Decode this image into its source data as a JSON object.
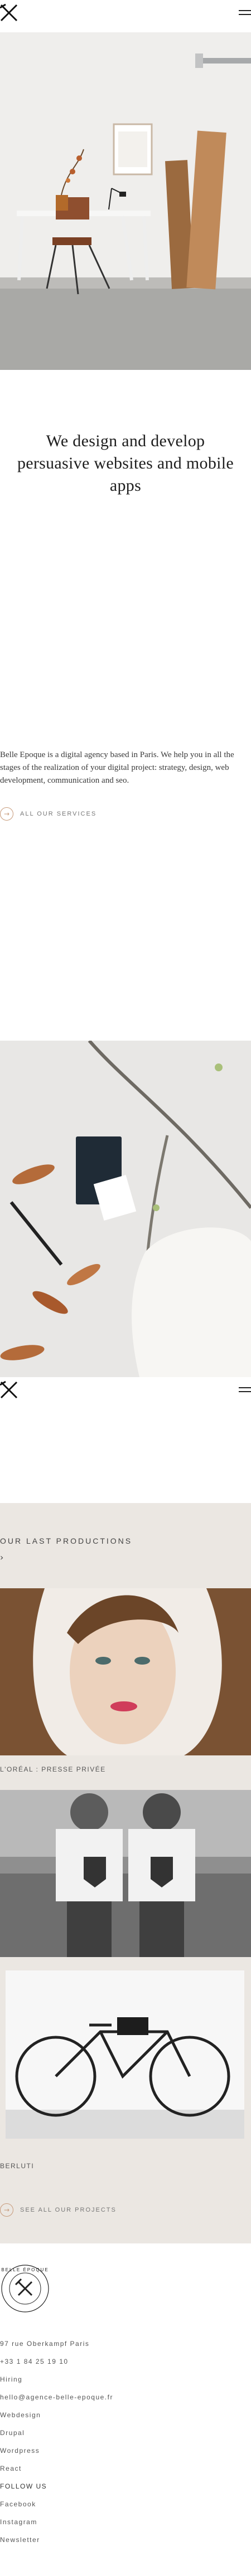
{
  "colors": {
    "accent": "#c79a7a",
    "section_bg": "#ebe7e2",
    "text": "#2a2a2a"
  },
  "header": {
    "logo_icon": "crossed-x-logo",
    "menu_icon": "hamburger-icon"
  },
  "hero": {
    "image_subject": "studio desk with chair, lamp, framed print and wooden planks"
  },
  "tagline": {
    "line1": "We design and develop",
    "line2": "persuasive websites and mobile apps"
  },
  "intro": {
    "paragraph": "Belle Epoque is a digital agency based in Paris. We help you in all the stages of the realization of your digital project: strategy, design, web development, communication and seo.",
    "link_label": "ALL OUR SERVICES"
  },
  "productions": {
    "heading": "OUR LAST PRODUCTIONS",
    "items": [
      {
        "label": "L'ORÉAL : PRESSE PRIVÉE"
      },
      {
        "label": ""
      },
      {
        "label": "BERLUTI"
      }
    ],
    "cta_label": "SEE ALL OUR PROJECTS"
  },
  "footer": {
    "seal_text": "BELLE ÉPOQUE",
    "address": "97 rue Oberkampf Paris",
    "phone": "+33 1 84 25 19 10",
    "hiring": "Hiring",
    "email": "hello@agence-belle-epoque.fr",
    "services": [
      "Webdesign",
      "Drupal",
      "Wordpress",
      "React"
    ],
    "follow_heading": "FOLLOW US",
    "social": [
      "Facebook",
      "Instagram",
      "Newsletter"
    ]
  }
}
